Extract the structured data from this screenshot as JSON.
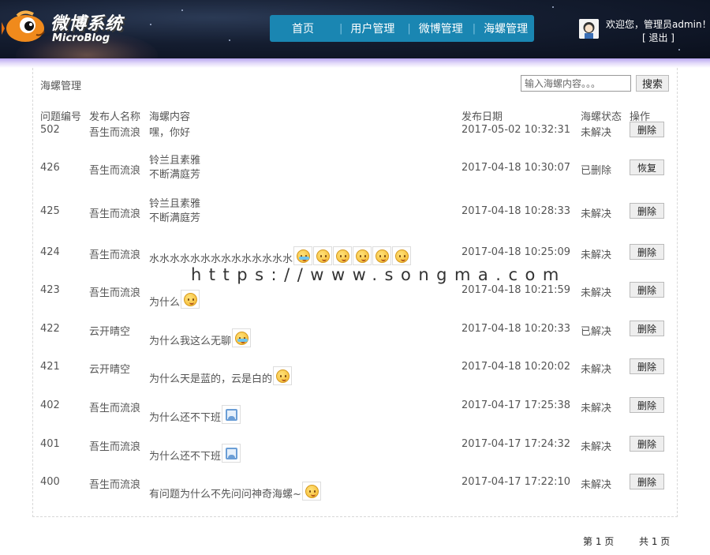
{
  "header": {
    "logo_title": "微博系统",
    "logo_subtitle": "MicroBlog",
    "nav": [
      {
        "label": "首页"
      },
      {
        "label": "用户管理"
      },
      {
        "label": "微博管理"
      },
      {
        "label": "海螺管理"
      }
    ],
    "welcome": "欢迎您，管理员admin！",
    "logout": "[ 退出 ]"
  },
  "page": {
    "title": "海螺管理",
    "search_placeholder": "输入海螺内容。。。",
    "search_button": "搜索"
  },
  "table": {
    "headers": {
      "id": "问题编号",
      "poster": "发布人名称",
      "content": "海螺内容",
      "date": "发布日期",
      "status": "海螺状态",
      "op": "操作"
    },
    "rows": [
      {
        "id": "502",
        "poster": "吾生而流浪",
        "content": "嘿，你好",
        "content2": "",
        "date": "2017-05-02 10:32:31",
        "status": "未解决",
        "op": "删除",
        "emojis": []
      },
      {
        "id": "426",
        "poster": "吾生而流浪",
        "content": "铃兰且素雅",
        "content2": "不断满庭芳",
        "date": "2017-04-18 10:30:07",
        "status": "已删除",
        "op": "恢复",
        "emojis": []
      },
      {
        "id": "425",
        "poster": "吾生而流浪",
        "content": "铃兰且素雅",
        "content2": "不断满庭芳",
        "date": "2017-04-18 10:28:33",
        "status": "未解决",
        "op": "删除",
        "emojis": []
      },
      {
        "id": "424",
        "poster": "吾生而流浪",
        "content": "水水水水水水水水水水水水水水",
        "content2": "",
        "date": "2017-04-18 10:25:09",
        "status": "未解决",
        "op": "删除",
        "emojis": [
          "cry-emoji",
          "smile-emoji",
          "smile-emoji",
          "smile-emoji",
          "smile-emoji",
          "smile-emoji"
        ]
      },
      {
        "id": "423",
        "poster": "吾生而流浪",
        "content": "为什么",
        "content2": "",
        "date": "2017-04-18 10:21:59",
        "status": "未解决",
        "op": "删除",
        "emojis": [
          "grin-emoji"
        ]
      },
      {
        "id": "422",
        "poster": "云开晴空",
        "content": "为什么我这么无聊",
        "content2": "",
        "date": "2017-04-18 10:20:33",
        "status": "已解决",
        "op": "删除",
        "emojis": [
          "cry-emoji"
        ]
      },
      {
        "id": "421",
        "poster": "云开晴空",
        "content": "为什么天是蓝的，云是白的",
        "content2": "",
        "date": "2017-04-18 10:20:02",
        "status": "未解决",
        "op": "删除",
        "emojis": [
          "think-emoji"
        ]
      },
      {
        "id": "402",
        "poster": "吾生而流浪",
        "content": "为什么还不下班",
        "content2": "",
        "date": "2017-04-17 17:25:38",
        "status": "未解决",
        "op": "删除",
        "emojis": [
          "image-icon"
        ]
      },
      {
        "id": "401",
        "poster": "吾生而流浪",
        "content": "为什么还不下班",
        "content2": "",
        "date": "2017-04-17 17:24:32",
        "status": "未解决",
        "op": "删除",
        "emojis": [
          "image-icon"
        ]
      },
      {
        "id": "400",
        "poster": "吾生而流浪",
        "content": "有问题为什么不先问问神奇海螺~",
        "content2": "",
        "date": "2017-04-17 17:22:10",
        "status": "未解决",
        "op": "删除",
        "emojis": [
          "sleepy-emoji"
        ]
      }
    ]
  },
  "watermark": "https://www.songma.com",
  "pager": {
    "current": "第 1 页",
    "total": "共 1 页"
  }
}
